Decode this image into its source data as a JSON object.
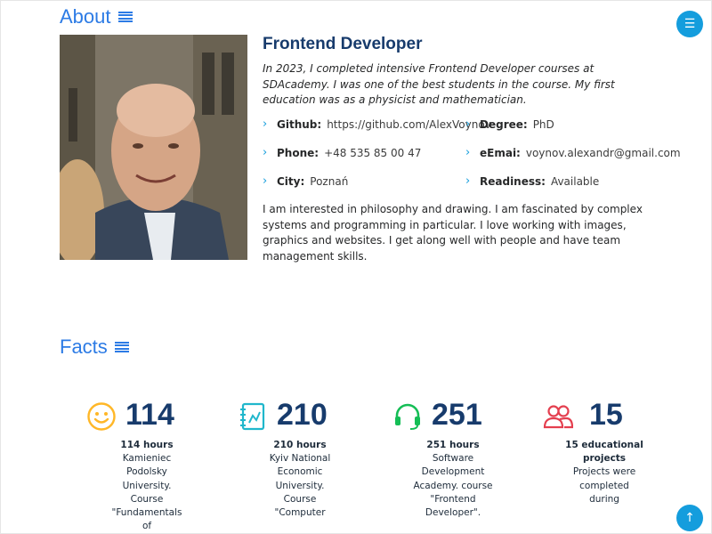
{
  "about": {
    "title": "About",
    "heading": "Frontend Developer",
    "intro": "In 2023, I completed intensive Frontend Developer courses at SDAcademy. I was one of the best students in the course. My first education was as a physicist and mathematician.",
    "info": [
      {
        "key": "Github:",
        "value": "https://github.com/AlexVoynov"
      },
      {
        "key": "Degree:",
        "value": "PhD"
      },
      {
        "key": "Phone:",
        "value": "+48 535 85 00 47"
      },
      {
        "key": "eEmai:",
        "value": "voynov.alexandr@gmail.com"
      },
      {
        "key": "City:",
        "value": "Poznań"
      },
      {
        "key": "Readiness:",
        "value": "Available"
      }
    ],
    "description": "I am interested in philosophy and drawing. I am fascinated by complex systems and programming in particular. I love working with images, graphics and websites. I get along well with people and have team management skills."
  },
  "facts": {
    "title": "Facts",
    "items": [
      {
        "number": "114",
        "lead": "114 hours",
        "text": "Kamieniec Podolsky University. Course \"Fundamentals of",
        "icon": "smile-icon",
        "color": "#ffb727"
      },
      {
        "number": "210",
        "lead": "210 hours",
        "text": "Kyiv National Economic University. Course \"Computer",
        "icon": "journal-icon",
        "color": "#20b7cc"
      },
      {
        "number": "251",
        "lead": "251 hours",
        "text": "Software Development Academy. course \"Frontend Developer\".",
        "icon": "headset-icon",
        "color": "#15be56"
      },
      {
        "number": "15",
        "lead": "15 educational projects",
        "text": "Projects were completed during",
        "icon": "people-icon",
        "color": "#e43f4f"
      }
    ]
  },
  "colors": {
    "accent": "#149ddd",
    "title": "#2c7be5",
    "heading": "#173b6c"
  }
}
